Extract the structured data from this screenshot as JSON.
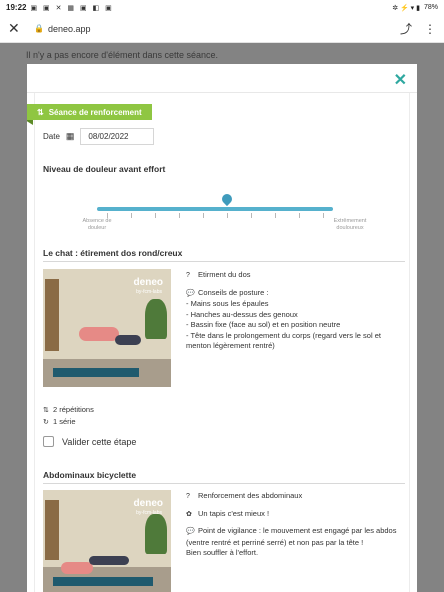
{
  "status_bar": {
    "time": "19:22",
    "notification_icons": "▣ ▣ ✕ ▦ ▣ ◧ ▣",
    "system_icons": "✲ ⚡ ▾ ▮",
    "battery": "78%"
  },
  "browser": {
    "close_icon": "✕",
    "lock_icon": "🔒",
    "domain": "deneo.app",
    "share_icon": "⤴",
    "more_icon": "⋮"
  },
  "page": {
    "notice": "Il n'y a pas encore d'élément dans cette séance."
  },
  "modal": {
    "close_icon": "✕",
    "badge": {
      "icon": "⇅",
      "label": "Séance de renforcement"
    },
    "date": {
      "label": "Date",
      "icon": "▦",
      "value": "08/02/2022"
    },
    "pain": {
      "title": "Niveau de douleur avant effort",
      "min_label": "Absence de douleur",
      "max_label": "Extrêmement douloureux",
      "value_fraction": 0.55
    },
    "exercises": [
      {
        "title": "Le chat : étirement dos rond/creux",
        "photo_logo": "deneo",
        "photo_logo_sub": "by-fcm-labs",
        "goal_icon": "?",
        "goal": "Etirment du dos",
        "tips_icon": "💬",
        "tips_title": "Conseils de posture :",
        "tips": [
          "- Mains sous les épaules",
          "- Hanches au-dessus des genoux",
          "- Bassin fixe (face au sol) et en position neutre",
          "- Tête dans le prolongement du corps (regard vers le sol et",
          "menton légèrement rentré)"
        ],
        "reps_icon": "⇅",
        "reps": "2 répétitions",
        "series_icon": "↻",
        "series": "1 série",
        "validate": "Valider cette étape"
      },
      {
        "title": "Abdominaux bicyclette",
        "photo_logo": "deneo",
        "photo_logo_sub": "by-fcm-labs",
        "goal_icon": "?",
        "goal": "Renforcement des abdominaux",
        "equip_icon": "✿",
        "equip": "Un tapis c'est mieux !",
        "tips_icon": "💬",
        "tips": [
          "Point de vigilance : le mouvement est engagé par les abdos",
          "(ventre rentré et perriné serré) et non pas par la tête !",
          "Bien souffler à l'effort."
        ]
      }
    ]
  }
}
